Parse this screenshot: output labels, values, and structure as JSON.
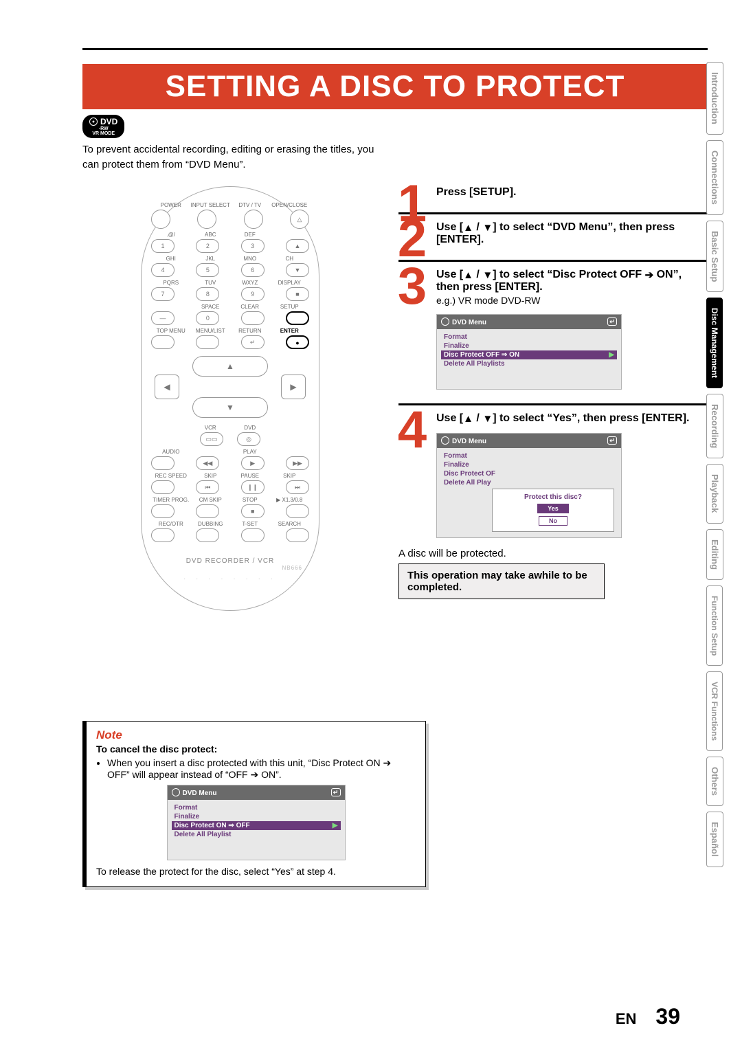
{
  "header": {
    "title": "SETTING A DISC TO PROTECT",
    "dvd_badge_top": "DVD",
    "dvd_badge_sub1": "-RW",
    "dvd_badge_sub2": "VR MODE"
  },
  "intro": "To prevent accidental recording, editing or erasing the titles, you can protect them from “DVD Menu”.",
  "remote": {
    "labels_row1": [
      "POWER",
      "INPUT SELECT",
      "DTV / TV",
      "OPEN/CLOSE"
    ],
    "eject": "△",
    "labels_row2": [
      ".@/",
      "ABC",
      "DEF",
      ""
    ],
    "nums_row2": [
      "1",
      "2",
      "3",
      "▲"
    ],
    "labels_row3": [
      "GHI",
      "JKL",
      "MNO",
      "CH"
    ],
    "nums_row3": [
      "4",
      "5",
      "6",
      "▼"
    ],
    "labels_row4": [
      "PQRS",
      "TUV",
      "WXYZ",
      "DISPLAY"
    ],
    "nums_row4": [
      "7",
      "8",
      "9",
      "■"
    ],
    "labels_row5": [
      "",
      "SPACE",
      "CLEAR",
      "SETUP"
    ],
    "nums_row5": [
      "—",
      "0",
      "",
      ""
    ],
    "labels_row6": [
      "TOP MENU",
      "MENU/LIST",
      "RETURN",
      "ENTER"
    ],
    "nav_up": "▲",
    "nav_down": "▼",
    "nav_left": "◀",
    "nav_right": "▶",
    "labels_row7": [
      "",
      "VCR",
      "DVD",
      ""
    ],
    "vcr_icon": "▭▭",
    "dvd_icon": "◎",
    "labels_row8": [
      "AUDIO",
      "",
      "PLAY",
      ""
    ],
    "pb_icons": [
      "◀◀",
      "▶",
      "▶▶"
    ],
    "labels_row9": [
      "REC SPEED",
      "SKIP",
      "PAUSE",
      "SKIP"
    ],
    "pb_icons2": [
      "⏮",
      "❙❙",
      "⏭"
    ],
    "labels_row10": [
      "TIMER PROG.",
      "CM SKIP",
      "STOP",
      "▶ X1.3/0.8"
    ],
    "stop_icon": "■",
    "labels_row11": [
      "REC/OTR",
      "DUBBING",
      "T-SET",
      "SEARCH"
    ],
    "footer": "DVD RECORDER / VCR",
    "footer_nb": "NB666"
  },
  "steps": {
    "s1": {
      "num": "1",
      "text": "Press [SETUP]."
    },
    "s2": {
      "num": "2",
      "text_a": "Use [",
      "text_b": " / ",
      "text_c": "] to select “DVD Menu”, then press [ENTER]."
    },
    "s3": {
      "num": "3",
      "text_a": "Use [",
      "text_b": " / ",
      "text_c": "] to select “Disc Protect OFF ",
      "text_d": " ON”, then press [ENTER].",
      "sub": "e.g.) VR mode DVD-RW",
      "osd": {
        "title": "DVD Menu",
        "rows": [
          "Format",
          "Finalize",
          "Disc Protect OFF ⇒ ON",
          "Delete All Playlists"
        ],
        "selected": 2
      }
    },
    "s4": {
      "num": "4",
      "text_a": "Use [",
      "text_b": " / ",
      "text_c": "] to select “Yes”, then press [ENTER].",
      "osd": {
        "title": "DVD Menu",
        "rows": [
          "Format",
          "Finalize",
          "Disc Protect OF",
          "Delete All Play"
        ],
        "dialog_q": "Protect this disc?",
        "opt_yes": "Yes",
        "opt_no": "No"
      },
      "after": "A disc will be protected.",
      "hint": "This operation may take awhile to be completed."
    }
  },
  "note": {
    "heading": "Note",
    "subheading": "To cancel the disc protect:",
    "bullet": "When you insert a disc protected with this unit, “Disc Protect ON ➔ OFF” will appear instead of “OFF ➔ ON”.",
    "osd": {
      "title": "DVD Menu",
      "rows": [
        "Format",
        "Finalize",
        "Disc Protect ON ⇒ OFF",
        "Delete All Playlist"
      ],
      "selected": 2
    },
    "last": "To release the protect for the disc, select “Yes” at step 4."
  },
  "tabs": [
    "Introduction",
    "Connections",
    "Basic Setup",
    "Disc Management",
    "Recording",
    "Playback",
    "Editing",
    "Function Setup",
    "VCR Functions",
    "Others",
    "Español"
  ],
  "tabs_active_index": 3,
  "footer": {
    "lang": "EN",
    "page": "39"
  },
  "glyphs": {
    "up": "▲",
    "down": "▼",
    "arrow_right": "➔",
    "return": "↵"
  }
}
